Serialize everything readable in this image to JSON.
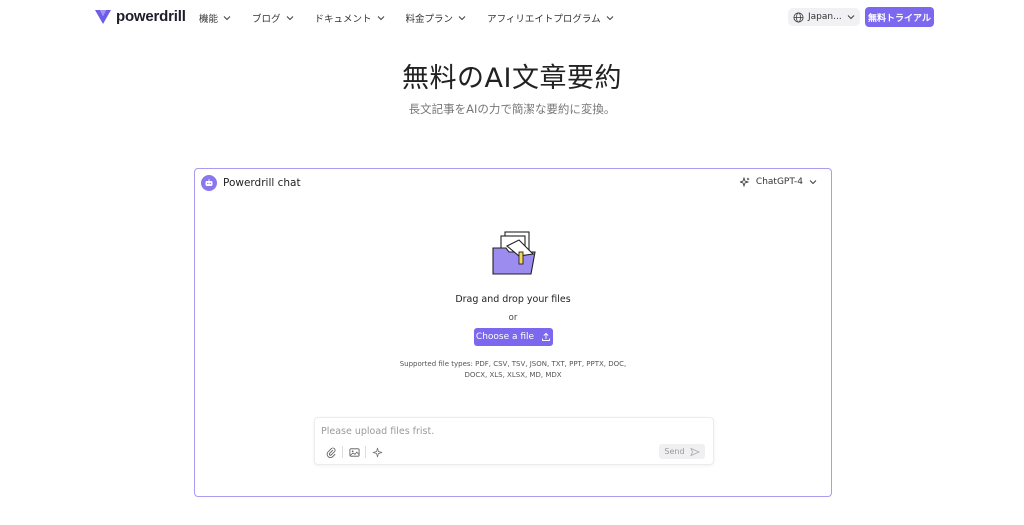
{
  "header": {
    "brand": "powerdrill",
    "nav": [
      {
        "label": "機能"
      },
      {
        "label": "ブログ"
      },
      {
        "label": "ドキュメント"
      },
      {
        "label": "料金プラン"
      },
      {
        "label": "アフィリエイトプログラム"
      }
    ],
    "language": "Japan...",
    "trial_label": "無料トライアル"
  },
  "hero": {
    "title": "無料のAI文章要約",
    "subtitle": "長文記事をAIの力で簡潔な要約に変換。"
  },
  "chat": {
    "title": "Powerdrill chat",
    "model": "ChatGPT-4",
    "drag_text": "Drag and drop your files",
    "or_text": "or",
    "choose_label": "Choose a file",
    "supported_line1": "Supported file types: PDF, CSV, TSV, JSON, TXT, PPT, PPTX, DOC,",
    "supported_line2": "DOCX, XLS, XLSX, MD, MDX",
    "input_placeholder": "Please upload files frist.",
    "send_label": "Send"
  },
  "colors": {
    "accent": "#7b68ee",
    "panel_border": "#a99cf0"
  },
  "icons": [
    "powerdrill-logo-icon",
    "chevron-down-icon",
    "globe-icon",
    "bot-icon",
    "sparkle-icon",
    "folder-icon",
    "upload-icon",
    "paperclip-icon",
    "image-icon",
    "sparkle-tool-icon",
    "send-icon"
  ]
}
